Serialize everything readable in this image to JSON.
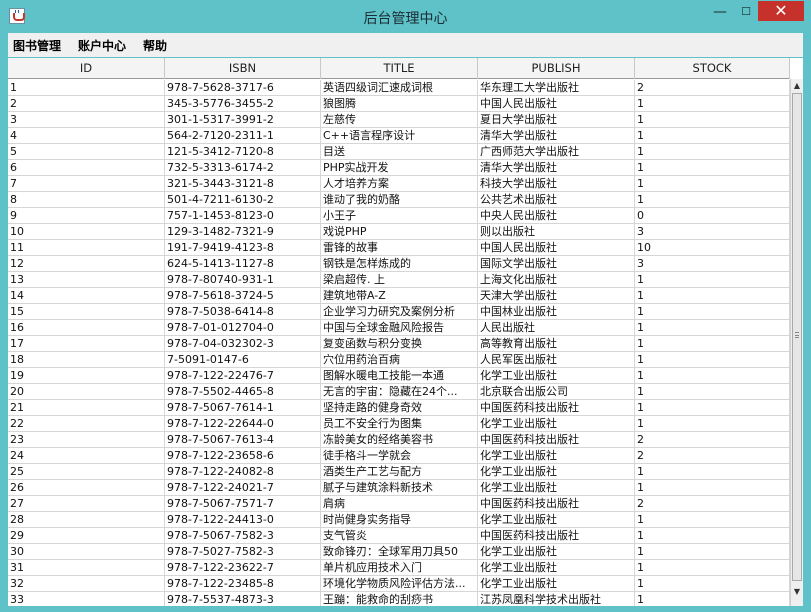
{
  "window": {
    "title": "后台管理中心",
    "minimize_glyph": "—",
    "maximize_glyph": "☐",
    "close_glyph": "✕",
    "accent": "#5fc2c9",
    "close_color": "#c7312b"
  },
  "menu": {
    "items": [
      "图书管理",
      "账户中心",
      "帮助"
    ]
  },
  "table": {
    "columns": [
      "ID",
      "ISBN",
      "TITLE",
      "PUBLISH",
      "STOCK"
    ],
    "rows": [
      [
        "1",
        "978-7-5628-3717-6",
        "英语四级词汇速成词根",
        "华东理工大学出版社",
        "2"
      ],
      [
        "2",
        "345-3-5776-3455-2",
        "狼图腾",
        "中国人民出版社",
        "1"
      ],
      [
        "3",
        "301-1-5317-3991-2",
        "左慈传",
        "夏日大学出版社",
        "1"
      ],
      [
        "4",
        "564-2-7120-2311-1",
        "C++语言程序设计",
        "清华大学出版社",
        "1"
      ],
      [
        "5",
        "121-5-3412-7120-8",
        "目送",
        "广西师范大学出版社",
        "1"
      ],
      [
        "6",
        "732-5-3313-6174-2",
        "PHP实战开发",
        "清华大学出版社",
        "1"
      ],
      [
        "7",
        "321-5-3443-3121-8",
        "人才培养方案",
        "科技大学出版社",
        "1"
      ],
      [
        "8",
        "501-4-7211-6130-2",
        "谁动了我的奶酪",
        "公共艺术出版社",
        "1"
      ],
      [
        "9",
        "757-1-1453-8123-0",
        "小王子",
        "中央人民出版社",
        "0"
      ],
      [
        "10",
        "129-3-1482-7321-9",
        "戏说PHP",
        "则以出版社",
        "3"
      ],
      [
        "11",
        "191-7-9419-4123-8",
        "雷锋的故事",
        "中国人民出版社",
        "10"
      ],
      [
        "12",
        "624-5-1413-1127-8",
        "钢铁是怎样炼成的",
        "国际文学出版社",
        "3"
      ],
      [
        "13",
        "978-7-80740-931-1",
        "梁启超传. 上",
        "上海文化出版社",
        "1"
      ],
      [
        "14",
        "978-7-5618-3724-5",
        "建筑地带A-Z",
        "天津大学出版社",
        "1"
      ],
      [
        "15",
        "978-7-5038-6414-8",
        "企业学习力研究及案例分析",
        "中国林业出版社",
        "1"
      ],
      [
        "16",
        "978-7-01-012704-0",
        "中国与全球金融风险报告",
        "人民出版社",
        "1"
      ],
      [
        "17",
        "978-7-04-032302-3",
        "复变函数与积分变换",
        "高等教育出版社",
        "1"
      ],
      [
        "18",
        "7-5091-0147-6",
        "穴位用药治百病",
        "人民军医出版社",
        "1"
      ],
      [
        "19",
        "978-7-122-22476-7",
        "图解水暖电工技能一本通",
        "化学工业出版社",
        "1"
      ],
      [
        "20",
        "978-7-5502-4465-8",
        "无言的宇宙：隐藏在24个...",
        "北京联合出版公司",
        "1"
      ],
      [
        "21",
        "978-7-5067-7614-1",
        "坚持走路的健身奇效",
        "中国医药科技出版社",
        "1"
      ],
      [
        "22",
        "978-7-122-22644-0",
        "员工不安全行为图集",
        "化学工业出版社",
        "1"
      ],
      [
        "23",
        "978-7-5067-7613-4",
        "冻龄美女的经络美容书",
        "中国医药科技出版社",
        "2"
      ],
      [
        "24",
        "978-7-122-23658-6",
        "徒手格斗一学就会",
        "化学工业出版社",
        "2"
      ],
      [
        "25",
        "978-7-122-24082-8",
        "酒类生产工艺与配方",
        "化学工业出版社",
        "1"
      ],
      [
        "26",
        "978-7-122-24021-7",
        "腻子与建筑涂料新技术",
        "化学工业出版社",
        "1"
      ],
      [
        "27",
        "978-7-5067-7571-7",
        "肩病",
        "中国医药科技出版社",
        "2"
      ],
      [
        "28",
        "978-7-122-24413-0",
        "时尚健身实务指导",
        "化学工业出版社",
        "1"
      ],
      [
        "29",
        "978-7-5067-7582-3",
        "支气管炎",
        "中国医药科技出版社",
        "1"
      ],
      [
        "30",
        "978-7-5027-7582-3",
        "致命锋刃：全球军用刀具50",
        "化学工业出版社",
        "1"
      ],
      [
        "31",
        "978-7-122-23622-7",
        "单片机应用技术入门",
        "化学工业出版社",
        "1"
      ],
      [
        "32",
        "978-7-122-23485-8",
        "环境化学物质风险评估方法...",
        "化学工业出版社",
        "1"
      ],
      [
        "33",
        "978-7-5537-4873-3",
        "王蹦：能救命的刮痧书",
        "江苏凤凰科学技术出版社",
        "1"
      ]
    ]
  }
}
